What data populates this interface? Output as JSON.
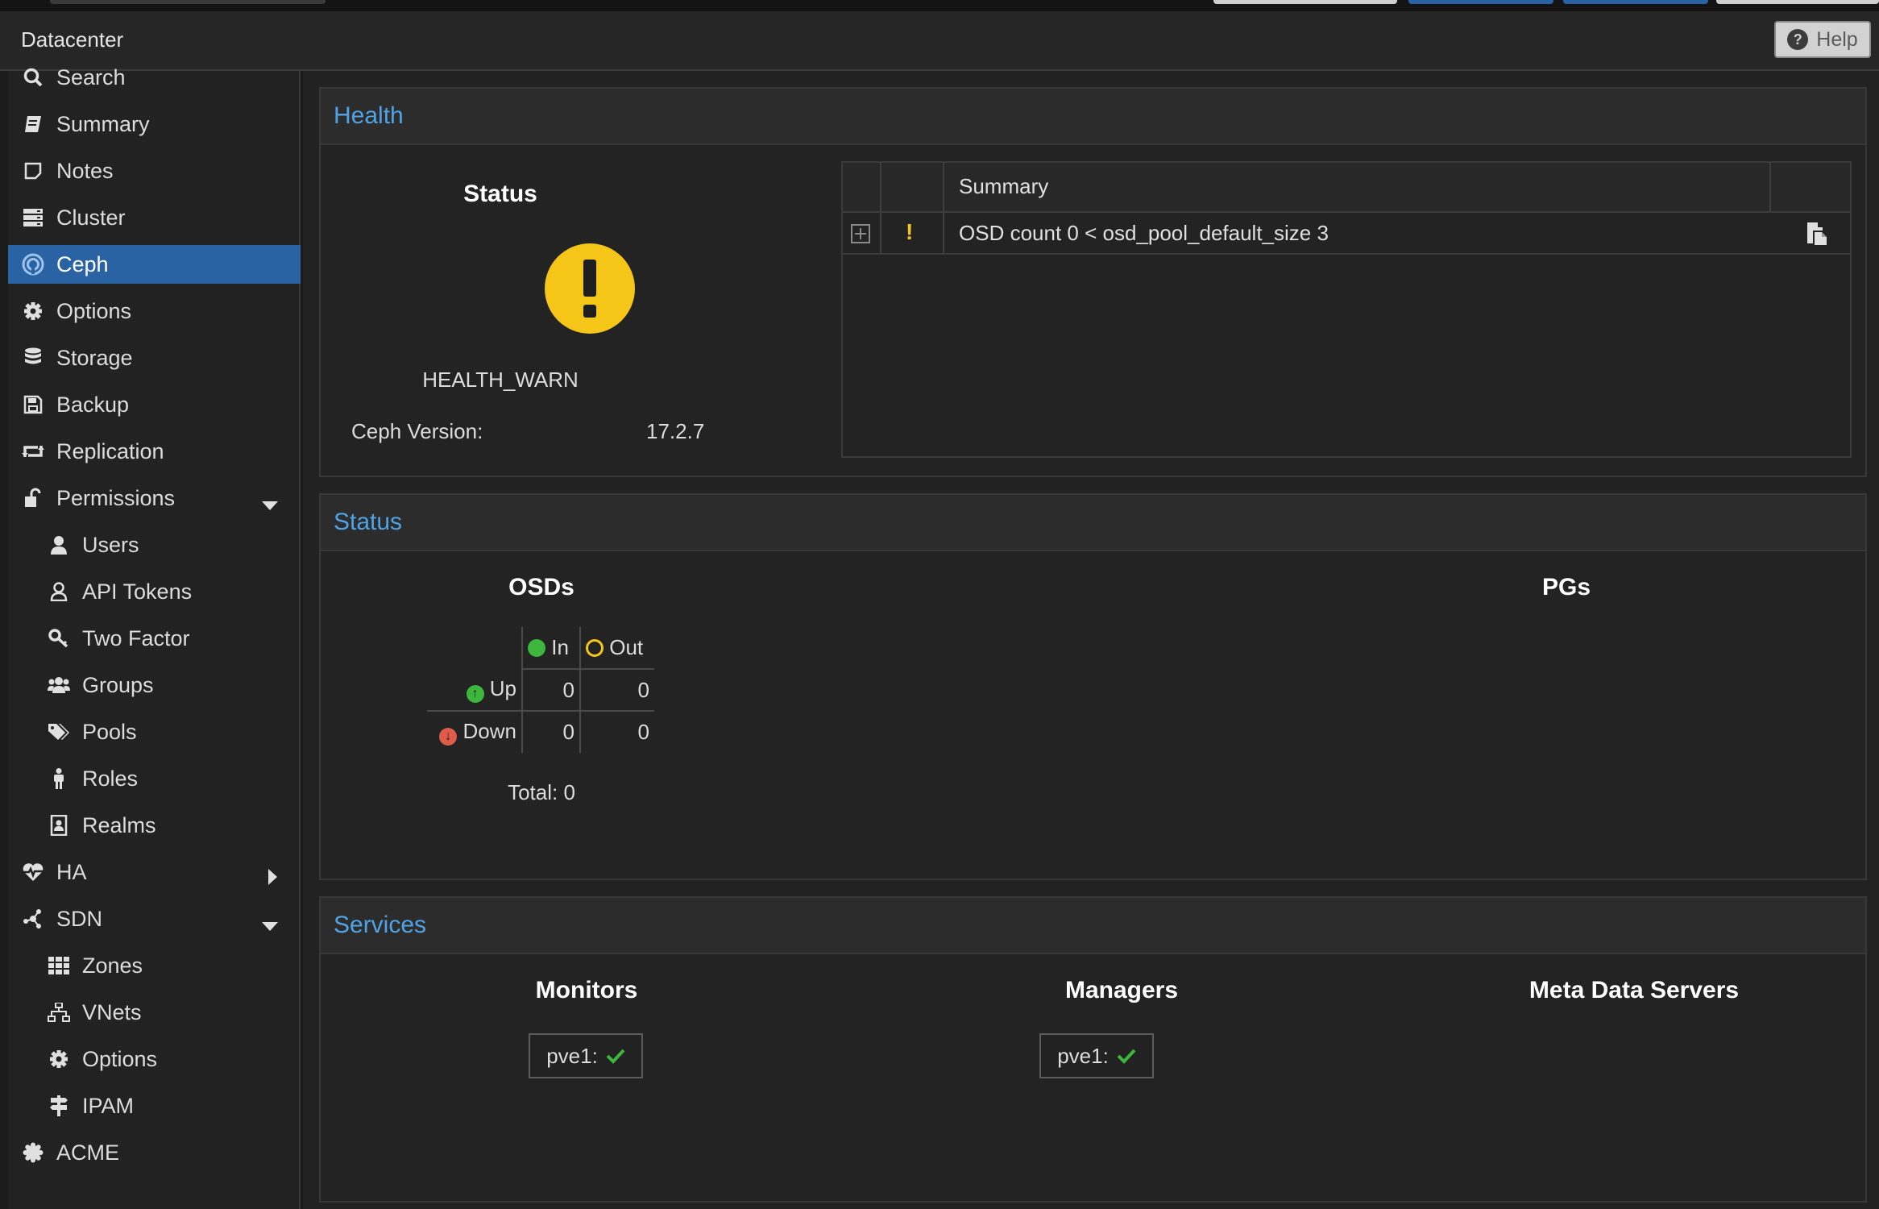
{
  "header": {
    "title": "Datacenter",
    "help_label": "Help"
  },
  "sidebar": {
    "items": [
      {
        "label": "Search",
        "icon": "search-icon"
      },
      {
        "label": "Summary",
        "icon": "book-icon"
      },
      {
        "label": "Notes",
        "icon": "sticky-note-icon"
      },
      {
        "label": "Cluster",
        "icon": "server-icon"
      },
      {
        "label": "Ceph",
        "icon": "ceph-icon",
        "selected": true
      },
      {
        "label": "Options",
        "icon": "gear-icon"
      },
      {
        "label": "Storage",
        "icon": "database-icon"
      },
      {
        "label": "Backup",
        "icon": "floppy-icon"
      },
      {
        "label": "Replication",
        "icon": "retweet-icon"
      },
      {
        "label": "Permissions",
        "icon": "unlock-icon",
        "expanded": true
      },
      {
        "label": "Users",
        "icon": "user-icon"
      },
      {
        "label": "API Tokens",
        "icon": "user-outline-icon"
      },
      {
        "label": "Two Factor",
        "icon": "key-icon"
      },
      {
        "label": "Groups",
        "icon": "users-icon"
      },
      {
        "label": "Pools",
        "icon": "tags-icon"
      },
      {
        "label": "Roles",
        "icon": "male-icon"
      },
      {
        "label": "Realms",
        "icon": "address-book-icon"
      },
      {
        "label": "HA",
        "icon": "heartbeat-icon",
        "expanded": false
      },
      {
        "label": "SDN",
        "icon": "network-icon",
        "expanded": true
      },
      {
        "label": "Zones",
        "icon": "grid-icon"
      },
      {
        "label": "VNets",
        "icon": "sitemap-icon"
      },
      {
        "label": "Options",
        "icon": "gear-icon"
      },
      {
        "label": "IPAM",
        "icon": "signpost-icon"
      },
      {
        "label": "ACME",
        "icon": "certificate-icon"
      }
    ]
  },
  "health": {
    "panel_title": "Health",
    "status_title": "Status",
    "status_text": "HEALTH_WARN",
    "version_label": "Ceph Version:",
    "version_value": "17.2.7",
    "grid": {
      "column_summary": "Summary",
      "rows": [
        {
          "severity": "!",
          "summary": "OSD count 0 < osd_pool_default_size 3"
        }
      ]
    }
  },
  "status": {
    "panel_title": "Status",
    "osds_title": "OSDs",
    "pgs_title": "PGs",
    "col_in": "In",
    "col_out": "Out",
    "row_up": "Up",
    "row_down": "Down",
    "up_in": "0",
    "up_out": "0",
    "down_in": "0",
    "down_out": "0",
    "total": "Total: 0"
  },
  "services": {
    "panel_title": "Services",
    "monitors_title": "Monitors",
    "managers_title": "Managers",
    "mds_title": "Meta Data Servers",
    "monitor_host": "pve1:",
    "manager_host": "pve1:"
  },
  "colors": {
    "accent": "#2a63a4",
    "link": "#4fa3e6",
    "warn": "#f5c518",
    "ok": "#3cb73c",
    "down": "#e05c4a"
  }
}
